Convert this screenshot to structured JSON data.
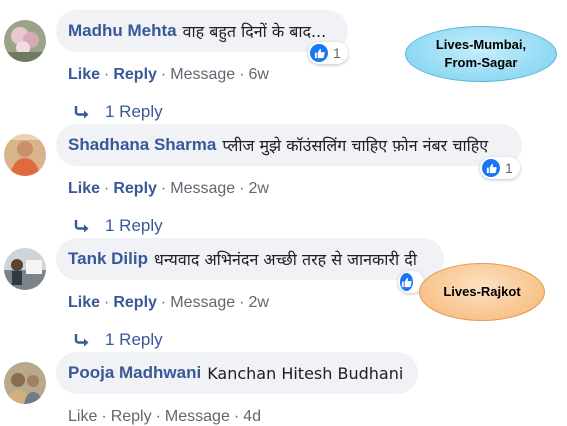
{
  "comments": [
    {
      "author": "Madhu Mehta",
      "text": "वाह बहुत दिनों के बाद...",
      "reactions": "1",
      "actions": {
        "like": "Like",
        "reply": "Reply",
        "message": "Message",
        "time": "6w"
      },
      "replies": "1 Reply"
    },
    {
      "author": "Shadhana Sharma",
      "text": "प्लीज मुझे कॉउंसलिंग चाहिए फ़ोन नंबर चाहिए",
      "reactions": "1",
      "actions": {
        "like": "Like",
        "reply": "Reply",
        "message": "Message",
        "time": "2w"
      },
      "replies": "1 Reply"
    },
    {
      "author": "Tank Dilip",
      "text": "धन्यवाद अभिनंदन अच्छी तरह से जानकारी दी",
      "reactions": "",
      "actions": {
        "like": "Like",
        "reply": "Reply",
        "message": "Message",
        "time": "2w"
      },
      "replies": "1 Reply"
    },
    {
      "author": "Pooja Madhwani",
      "text": "Kanchan Hitesh Budhani",
      "actions": {
        "like": "Like",
        "reply": "Reply",
        "message": "Message",
        "time": "4d"
      }
    }
  ],
  "callouts": {
    "blue": {
      "line1": "Lives-Mumbai,",
      "line2": "From-Sagar"
    },
    "orange": {
      "line1": "Lives-Rajkot"
    }
  },
  "colors": {
    "link": "#385898",
    "meta": "#606770",
    "bubble": "#f0f2f5",
    "like_blue": "#1877f2"
  },
  "icons": {
    "reaction": "thumbs-up-icon",
    "reply": "reply-arrow-icon"
  }
}
